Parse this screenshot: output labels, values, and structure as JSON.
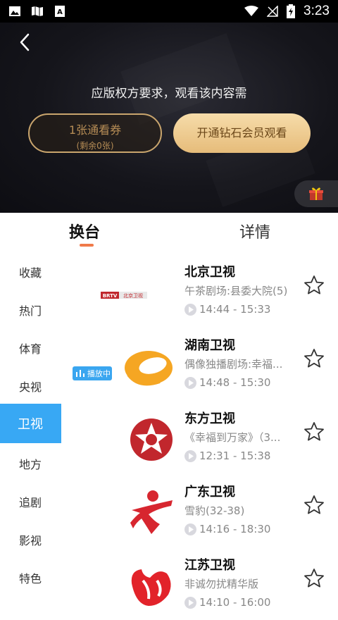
{
  "status_bar": {
    "time": "3:23"
  },
  "player": {
    "prompt": "应版权方要求，观看该内容需",
    "ticket_button": {
      "line1": "1张通看券",
      "line2": "(剩余0张)"
    },
    "vip_button": "开通钻石会员观看"
  },
  "tabs": [
    {
      "label": "换台",
      "active": true
    },
    {
      "label": "详情",
      "active": false
    }
  ],
  "sidebar": {
    "items": [
      {
        "label": "收藏"
      },
      {
        "label": "热门"
      },
      {
        "label": "体育"
      },
      {
        "label": "央视"
      },
      {
        "label": "卫视",
        "active": true
      },
      {
        "label": "地方"
      },
      {
        "label": "追剧"
      },
      {
        "label": "影视"
      },
      {
        "label": "特色"
      }
    ]
  },
  "channels": [
    {
      "name": "北京卫视",
      "program": "午茶剧场:县委大院(5)",
      "time": "14:44 - 15:33",
      "logo_text": "BRTV 北京卫视",
      "logo": "brtv-logo"
    },
    {
      "name": "湖南卫视",
      "program": "偶像独播剧场:幸福...",
      "time": "14:48 - 15:30",
      "logo": "hunan-logo",
      "playing_badge": "播放中"
    },
    {
      "name": "东方卫视",
      "program": "《幸福到万家》（3...",
      "time": "12:31 - 15:38",
      "logo": "dragon-logo"
    },
    {
      "name": "广东卫视",
      "program": "雪豹(32-38)",
      "time": "14:16 - 18:30",
      "logo": "guangdong-logo"
    },
    {
      "name": "江苏卫视",
      "program": "非诚勿扰精华版",
      "time": "14:10 - 16:00",
      "logo": "jiangsu-logo"
    }
  ],
  "colors": {
    "accent": "#38a8f4",
    "tab_underline": "#f07a4a",
    "gold": "#e6bc7a"
  }
}
